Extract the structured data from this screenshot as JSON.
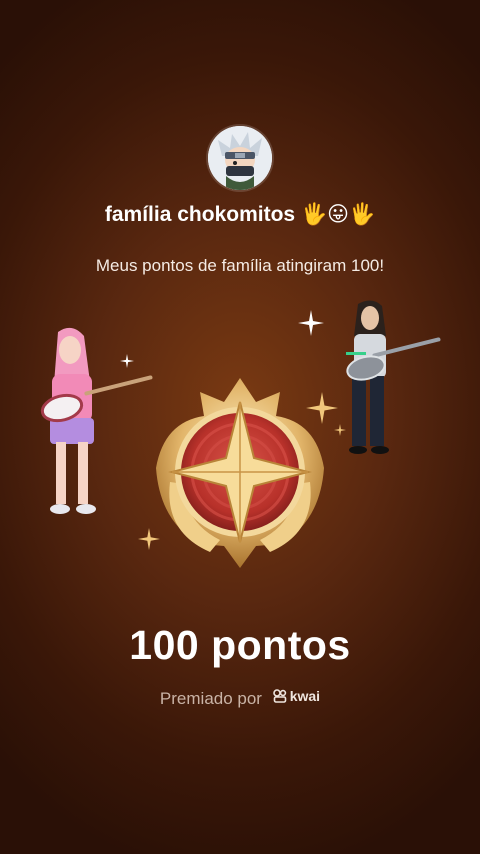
{
  "family": {
    "name": "família chokomitos",
    "emojis": "🖐😛🖐"
  },
  "message": "Meus pontos de família atingiram 100!",
  "badge": {
    "points_label": "100 pontos"
  },
  "awarded": {
    "prefix": "Premiado por",
    "brand": "kwai"
  },
  "icons": {
    "avatar": "anime-ninja-avatar",
    "medal": "star-medal-icon",
    "brand_logo": "kwai-logo-icon"
  },
  "colors": {
    "background": "#5a2810",
    "medal_gold": "#e9c27a",
    "medal_red": "#b8312a"
  }
}
